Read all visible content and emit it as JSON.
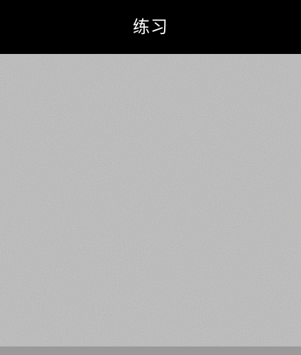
{
  "header": {
    "title": "练习"
  },
  "colors": {
    "header_bg": "#000000",
    "header_text": "#ffffff",
    "content_bg": "#808080",
    "footer_strip": "#9a9a9a"
  },
  "icons": {
    "content": "noise-image"
  }
}
